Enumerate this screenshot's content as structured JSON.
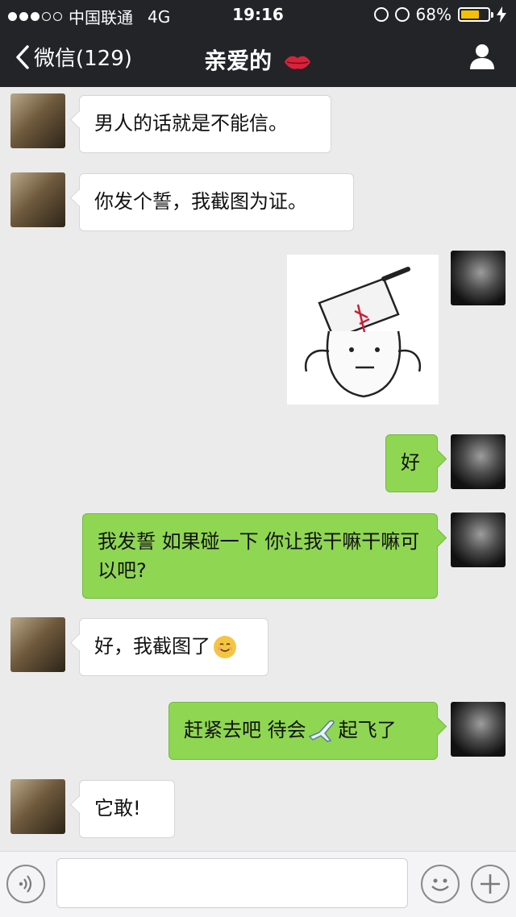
{
  "status_bar": {
    "carrier": "中国联通",
    "network": "4G",
    "time": "19:16",
    "battery_percent_label": "68%",
    "battery_level": 0.68,
    "signal_bars_filled": 3,
    "signal_bars_total": 5
  },
  "nav": {
    "back_label": "微信(129)",
    "title": "亲爱的",
    "title_icon": "kiss-lips-icon",
    "profile_icon": "profile-icon"
  },
  "messages": [
    {
      "from": "her",
      "text": "男人的话就是不能信。"
    },
    {
      "from": "her",
      "text": "你发个誓，我截图为证。"
    },
    {
      "from": "him",
      "type": "sticker",
      "sticker_icon": "cleaver-on-head-sticker"
    },
    {
      "from": "him",
      "text": "好"
    },
    {
      "from": "him",
      "text": "我发誓 如果碰一下 你让我干嘛干嘛可以吧?"
    },
    {
      "from": "her",
      "text": "好，我截图了",
      "emoji": "smile-emoji"
    },
    {
      "from": "him",
      "text_before": "赶紧去吧 待会",
      "emoji": "airplane-emoji",
      "text_after": "起飞了"
    },
    {
      "from": "her",
      "text": "它敢!"
    }
  ],
  "colors": {
    "nav_bg": "#232428",
    "chat_bg": "#ebebeb",
    "outgoing_bubble": "#8fd653",
    "incoming_bubble": "#ffffff",
    "battery_fill": "#f6c000"
  },
  "input_bar": {
    "voice_icon": "voice-icon",
    "emoji_icon": "emoji-icon",
    "plus_icon": "plus-icon"
  }
}
